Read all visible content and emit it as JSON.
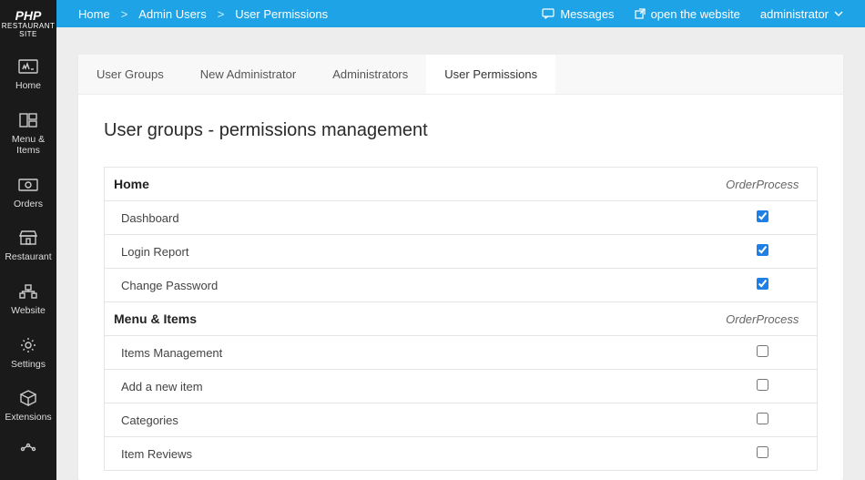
{
  "brand": {
    "top": "PHP",
    "bottom": "RESTAURANT SITE"
  },
  "sidebar": {
    "items": [
      {
        "label": "Home"
      },
      {
        "label": "Menu & Items"
      },
      {
        "label": "Orders"
      },
      {
        "label": "Restaurant"
      },
      {
        "label": "Website"
      },
      {
        "label": "Settings"
      },
      {
        "label": "Extensions"
      }
    ]
  },
  "breadcrumb": {
    "items": [
      "Home",
      "Admin Users",
      "User Permissions"
    ],
    "sep": ">"
  },
  "topbar": {
    "messages": "Messages",
    "open_site": "open the website",
    "user": "administrator"
  },
  "tabs": [
    {
      "label": "User Groups"
    },
    {
      "label": "New Administrator"
    },
    {
      "label": "Administrators"
    },
    {
      "label": "User Permissions"
    }
  ],
  "page_title": "User groups - permissions management",
  "group_header": "OrderProcess",
  "sections": [
    {
      "title": "Home",
      "rows": [
        {
          "label": "Dashboard",
          "checked": true
        },
        {
          "label": "Login Report",
          "checked": true
        },
        {
          "label": "Change Password",
          "checked": true
        }
      ]
    },
    {
      "title": "Menu & Items",
      "rows": [
        {
          "label": "Items Management",
          "checked": false
        },
        {
          "label": "Add a new item",
          "checked": false
        },
        {
          "label": "Categories",
          "checked": false
        },
        {
          "label": "Item Reviews",
          "checked": false
        }
      ]
    }
  ]
}
